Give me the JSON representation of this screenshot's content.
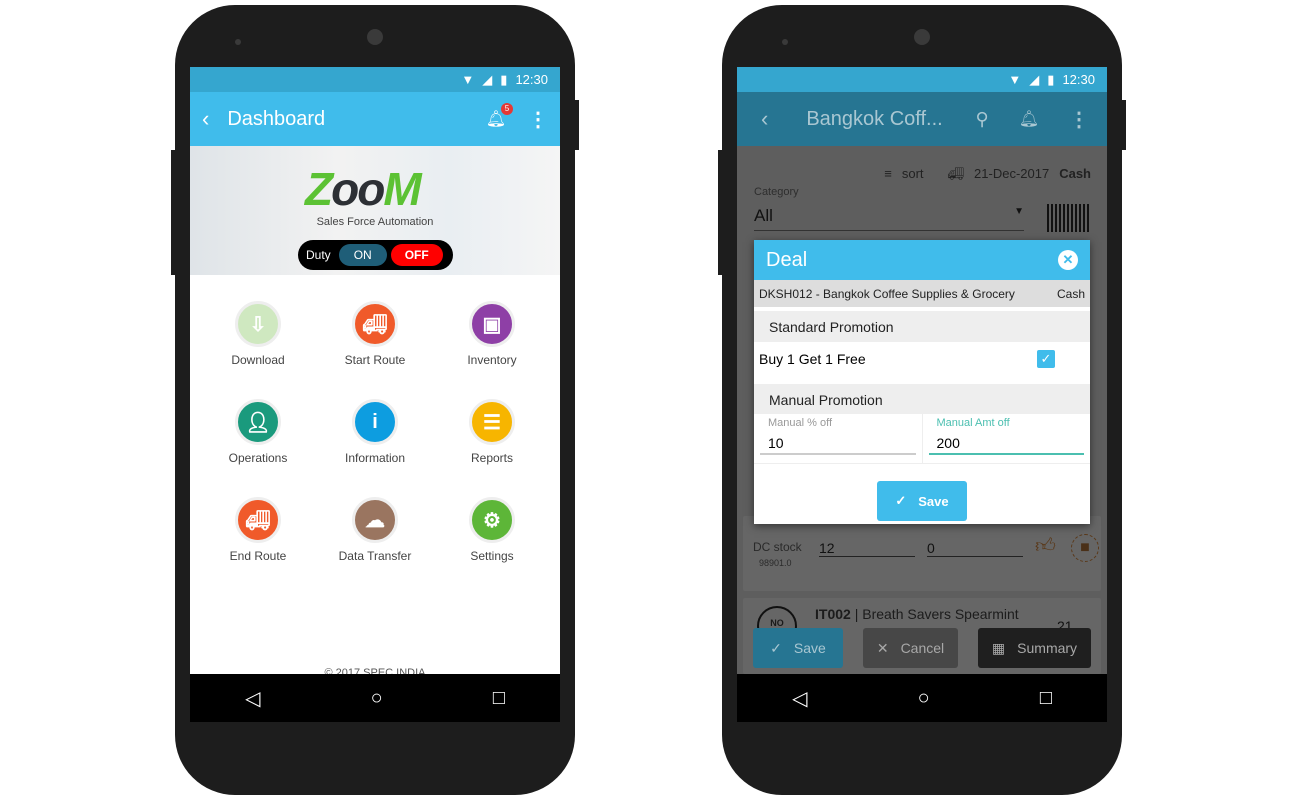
{
  "left_phone": {
    "status": {
      "time": "12:30"
    },
    "toolbar": {
      "title": "Dashboard",
      "notification_count": "5"
    },
    "banner": {
      "logo_text": "ZooM",
      "tagline": "Sales Force Automation",
      "duty_label": "Duty",
      "on_label": "ON",
      "off_label": "OFF"
    },
    "tiles": [
      {
        "label": "Download",
        "color": "#cfe8c0",
        "icon": "download-icon"
      },
      {
        "label": "Start Route",
        "color": "#f05a2a",
        "icon": "truck-clock-icon"
      },
      {
        "label": "Inventory",
        "color": "#8e3fa6",
        "icon": "inventory-icon"
      },
      {
        "label": "Operations",
        "color": "#1a9a7d",
        "icon": "operator-icon"
      },
      {
        "label": "Information",
        "color": "#0d9de0",
        "icon": "info-icon"
      },
      {
        "label": "Reports",
        "color": "#f7b500",
        "icon": "clipboard-icon"
      },
      {
        "label": "End Route",
        "color": "#f05a2a",
        "icon": "truck-end-icon"
      },
      {
        "label": "Data Transfer",
        "color": "#9a7560",
        "icon": "cloud-transfer-icon"
      },
      {
        "label": "Settings",
        "color": "#5db638",
        "icon": "gear-icon"
      }
    ],
    "footer": "© 2017 SPEC INDIA"
  },
  "right_phone": {
    "status": {
      "time": "12:30"
    },
    "toolbar": {
      "title": "Bangkok Coff..."
    },
    "filter": {
      "sort_label": "sort",
      "date": "21-Dec-2017",
      "payment": "Cash",
      "category_label": "Category",
      "category_value": "All"
    },
    "item": {
      "dc_stock_label": "DC stock",
      "dc_stock_value": "98901.0",
      "qty1": "12",
      "qty2": "0"
    },
    "item2": {
      "code": "IT002",
      "name": "Breath Savers Spearmint",
      "qty": "21",
      "no_image": "NO IMAGE"
    },
    "bottom": {
      "save": "Save",
      "cancel": "Cancel",
      "summary": "Summary"
    },
    "dialog": {
      "title": "Deal",
      "customer": "DKSH012 - Bangkok Coffee Supplies & Grocery",
      "payment": "Cash",
      "standard_header": "Standard Promotion",
      "standard_item": "Buy 1 Get 1 Free",
      "standard_checked": true,
      "manual_header": "Manual Promotion",
      "pct_label": "Manual % off",
      "pct_value": "10",
      "amt_label": "Manual Amt off",
      "amt_value": "200",
      "save": "Save"
    }
  }
}
